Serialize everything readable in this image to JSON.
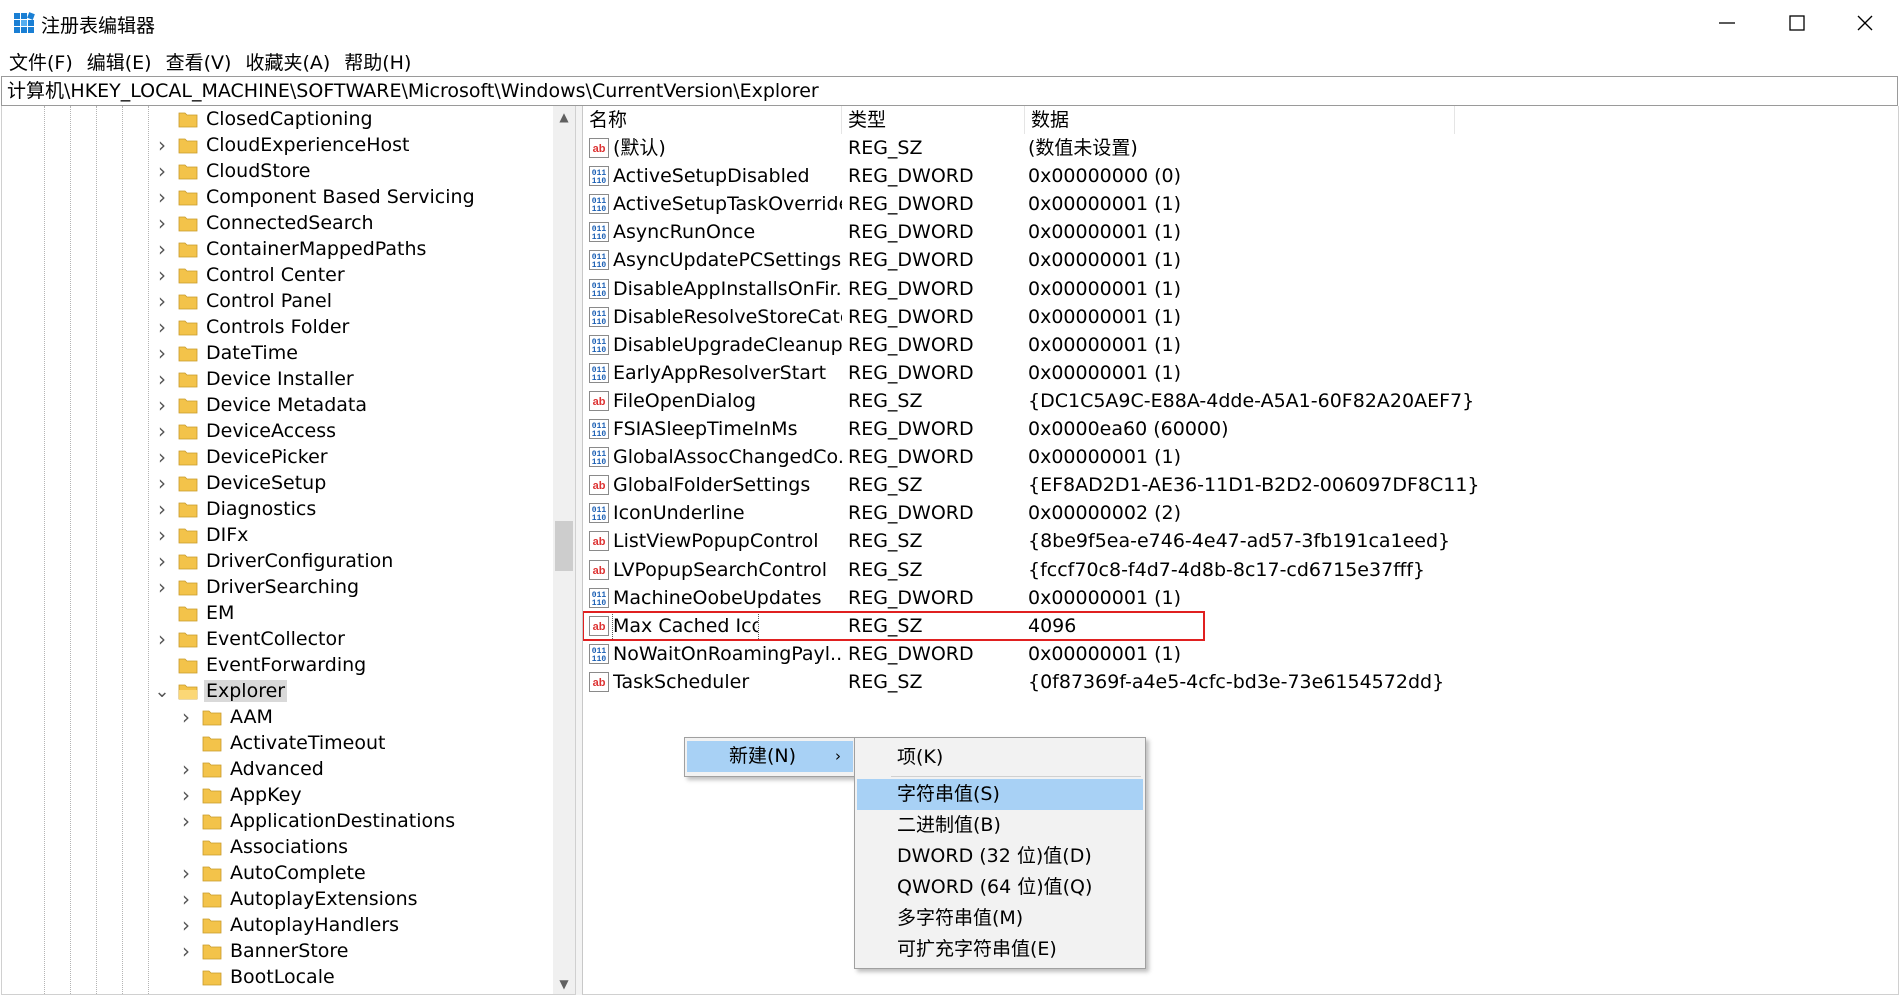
{
  "window": {
    "title": "注册表编辑器",
    "minimize": "—",
    "maximize": "☐",
    "close": "✕"
  },
  "menu": [
    "文件(F)",
    "编辑(E)",
    "查看(V)",
    "收藏夹(A)",
    "帮助(H)"
  ],
  "address": "计算机\\HKEY_LOCAL_MACHINE\\SOFTWARE\\Microsoft\\Windows\\CurrentVersion\\Explorer",
  "tree": {
    "items": [
      {
        "label": "ClosedCaptioning",
        "level": 0,
        "expandable": false
      },
      {
        "label": "CloudExperienceHost",
        "level": 0,
        "expandable": true
      },
      {
        "label": "CloudStore",
        "level": 0,
        "expandable": true
      },
      {
        "label": "Component Based Servicing",
        "level": 0,
        "expandable": true
      },
      {
        "label": "ConnectedSearch",
        "level": 0,
        "expandable": true
      },
      {
        "label": "ContainerMappedPaths",
        "level": 0,
        "expandable": true
      },
      {
        "label": "Control Center",
        "level": 0,
        "expandable": true
      },
      {
        "label": "Control Panel",
        "level": 0,
        "expandable": true
      },
      {
        "label": "Controls Folder",
        "level": 0,
        "expandable": true
      },
      {
        "label": "DateTime",
        "level": 0,
        "expandable": true
      },
      {
        "label": "Device Installer",
        "level": 0,
        "expandable": true
      },
      {
        "label": "Device Metadata",
        "level": 0,
        "expandable": true
      },
      {
        "label": "DeviceAccess",
        "level": 0,
        "expandable": true
      },
      {
        "label": "DevicePicker",
        "level": 0,
        "expandable": true
      },
      {
        "label": "DeviceSetup",
        "level": 0,
        "expandable": true
      },
      {
        "label": "Diagnostics",
        "level": 0,
        "expandable": true
      },
      {
        "label": "DIFx",
        "level": 0,
        "expandable": true
      },
      {
        "label": "DriverConfiguration",
        "level": 0,
        "expandable": true
      },
      {
        "label": "DriverSearching",
        "level": 0,
        "expandable": true
      },
      {
        "label": "EM",
        "level": 0,
        "expandable": false
      },
      {
        "label": "EventCollector",
        "level": 0,
        "expandable": true
      },
      {
        "label": "EventForwarding",
        "level": 0,
        "expandable": false
      },
      {
        "label": "Explorer",
        "level": 0,
        "expandable": true,
        "expanded": true,
        "selected": true
      },
      {
        "label": "AAM",
        "level": 1,
        "expandable": true
      },
      {
        "label": "ActivateTimeout",
        "level": 1,
        "expandable": false
      },
      {
        "label": "Advanced",
        "level": 1,
        "expandable": true
      },
      {
        "label": "AppKey",
        "level": 1,
        "expandable": true
      },
      {
        "label": "ApplicationDestinations",
        "level": 1,
        "expandable": true
      },
      {
        "label": "Associations",
        "level": 1,
        "expandable": false
      },
      {
        "label": "AutoComplete",
        "level": 1,
        "expandable": true
      },
      {
        "label": "AutoplayExtensions",
        "level": 1,
        "expandable": true
      },
      {
        "label": "AutoplayHandlers",
        "level": 1,
        "expandable": true
      },
      {
        "label": "BannerStore",
        "level": 1,
        "expandable": true
      },
      {
        "label": "BootLocale",
        "level": 1,
        "expandable": false
      }
    ]
  },
  "values_header": {
    "name": "名称",
    "type": "类型",
    "data": "数据"
  },
  "values": [
    {
      "icon": "ab",
      "name": "(默认)",
      "type": "REG_SZ",
      "data": "(数值未设置)"
    },
    {
      "icon": "bin",
      "name": "ActiveSetupDisabled",
      "type": "REG_DWORD",
      "data": "0x00000000 (0)"
    },
    {
      "icon": "bin",
      "name": "ActiveSetupTaskOverride",
      "type": "REG_DWORD",
      "data": "0x00000001 (1)"
    },
    {
      "icon": "bin",
      "name": "AsyncRunOnce",
      "type": "REG_DWORD",
      "data": "0x00000001 (1)"
    },
    {
      "icon": "bin",
      "name": "AsyncUpdatePCSettings",
      "type": "REG_DWORD",
      "data": "0x00000001 (1)"
    },
    {
      "icon": "bin",
      "name": "DisableAppInstallsOnFir...",
      "type": "REG_DWORD",
      "data": "0x00000001 (1)"
    },
    {
      "icon": "bin",
      "name": "DisableResolveStoreCate...",
      "type": "REG_DWORD",
      "data": "0x00000001 (1)"
    },
    {
      "icon": "bin",
      "name": "DisableUpgradeCleanup",
      "type": "REG_DWORD",
      "data": "0x00000001 (1)"
    },
    {
      "icon": "bin",
      "name": "EarlyAppResolverStart",
      "type": "REG_DWORD",
      "data": "0x00000001 (1)"
    },
    {
      "icon": "ab",
      "name": "FileOpenDialog",
      "type": "REG_SZ",
      "data": "{DC1C5A9C-E88A-4dde-A5A1-60F82A20AEF7}"
    },
    {
      "icon": "bin",
      "name": "FSIASleepTimeInMs",
      "type": "REG_DWORD",
      "data": "0x0000ea60 (60000)"
    },
    {
      "icon": "bin",
      "name": "GlobalAssocChangedCo...",
      "type": "REG_DWORD",
      "data": "0x00000001 (1)"
    },
    {
      "icon": "ab",
      "name": "GlobalFolderSettings",
      "type": "REG_SZ",
      "data": "{EF8AD2D1-AE36-11D1-B2D2-006097DF8C11}"
    },
    {
      "icon": "bin",
      "name": "IconUnderline",
      "type": "REG_DWORD",
      "data": "0x00000002 (2)"
    },
    {
      "icon": "ab",
      "name": "ListViewPopupControl",
      "type": "REG_SZ",
      "data": "{8be9f5ea-e746-4e47-ad57-3fb191ca1eed}"
    },
    {
      "icon": "ab",
      "name": "LVPopupSearchControl",
      "type": "REG_SZ",
      "data": "{fccf70c8-f4d7-4d8b-8c17-cd6715e37fff}"
    },
    {
      "icon": "bin",
      "name": "MachineOobeUpdates",
      "type": "REG_DWORD",
      "data": "0x00000001 (1)"
    },
    {
      "icon": "ab",
      "name": "Max Cached Icons",
      "type": "REG_SZ",
      "data": "4096",
      "highlight": true
    },
    {
      "icon": "bin",
      "name": "NoWaitOnRoamingPayl...",
      "type": "REG_DWORD",
      "data": "0x00000001 (1)"
    },
    {
      "icon": "ab",
      "name": "TaskScheduler",
      "type": "REG_SZ",
      "data": "{0f87369f-a4e5-4cfc-bd3e-73e6154572dd}"
    }
  ],
  "context_menu": {
    "new_label": "新建(N)",
    "submenu": [
      "项(K)",
      "字符串值(S)",
      "二进制值(B)",
      "DWORD (32 位)值(D)",
      "QWORD (64 位)值(Q)",
      "多字符串值(M)",
      "可扩充字符串值(E)"
    ],
    "hovered_index": 1
  },
  "colors": {
    "highlight_frame": "#e02020",
    "menu_hover": "#a8d1f5",
    "folder": "#f3c34a"
  }
}
